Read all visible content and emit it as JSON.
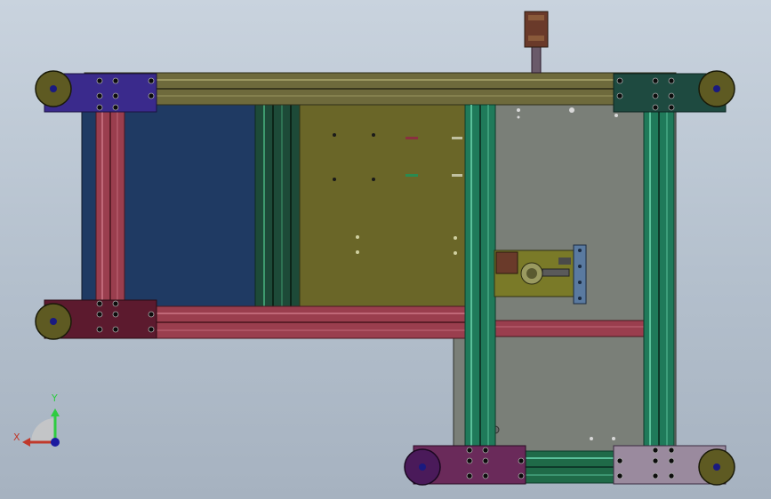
{
  "viewport": {
    "background_top": "#c9d3de",
    "background_bottom": "#a6b2c0"
  },
  "colors": {
    "beam_olive": "#6e6a3c",
    "beam_red": "#9a3e4e",
    "rail_green": "#1f7a5a",
    "panel_blue": "#1f3a63",
    "panel_olive": "#6a6628",
    "plate_gray": "#7a7f78",
    "wheel_olive": "#5e5a22",
    "wheel_purple": "#4a1a5a",
    "block_blue": "#3a2a8c",
    "block_teal": "#1e4a40",
    "block_maroon": "#5c1a2e",
    "block_magenta": "#6a2a5a",
    "block_lilac": "#9a8a9e",
    "motor_brown": "#6a3a2a"
  },
  "triad": {
    "x_label": "X",
    "y_label": "Y",
    "x_color": "#c0392b",
    "y_color": "#2ecc40",
    "z_color": "#1a1aa0"
  }
}
